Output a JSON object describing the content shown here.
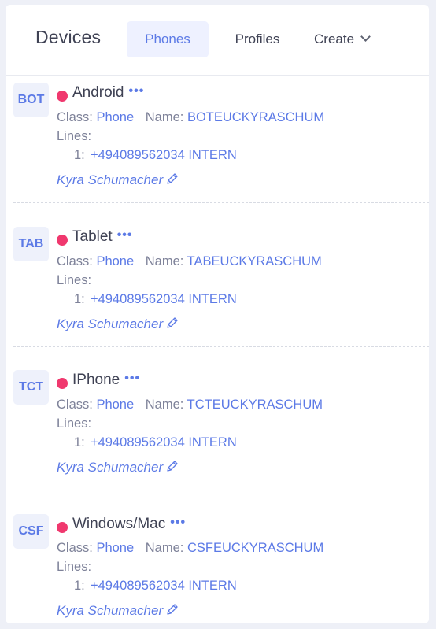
{
  "header": {
    "title": "Devices",
    "tabs": {
      "phones": "Phones",
      "profiles": "Profiles",
      "create": "Create"
    }
  },
  "labels": {
    "class": "Class:",
    "name": "Name:",
    "lines": "Lines:"
  },
  "colors": {
    "accent": "#5c7ae6",
    "status": "#f0386e"
  },
  "devices": [
    {
      "badge": "BOT",
      "name": "Android",
      "class_value": "Phone",
      "name_value": "BOTEUCKYRASCHUM",
      "line_index": "1:",
      "line_value": "+494089562034 INTERN",
      "owner": "Kyra Schumacher"
    },
    {
      "badge": "TAB",
      "name": "Tablet",
      "class_value": "Phone",
      "name_value": "TABEUCKYRASCHUM",
      "line_index": "1:",
      "line_value": "+494089562034 INTERN",
      "owner": "Kyra Schumacher"
    },
    {
      "badge": "TCT",
      "name": "IPhone",
      "class_value": "Phone",
      "name_value": "TCTEUCKYRASCHUM",
      "line_index": "1:",
      "line_value": "+494089562034 INTERN",
      "owner": "Kyra Schumacher"
    },
    {
      "badge": "CSF",
      "name": "Windows/Mac",
      "class_value": "Phone",
      "name_value": "CSFEUCKYRASCHUM",
      "line_index": "1:",
      "line_value": "+494089562034 INTERN",
      "owner": "Kyra Schumacher"
    }
  ]
}
